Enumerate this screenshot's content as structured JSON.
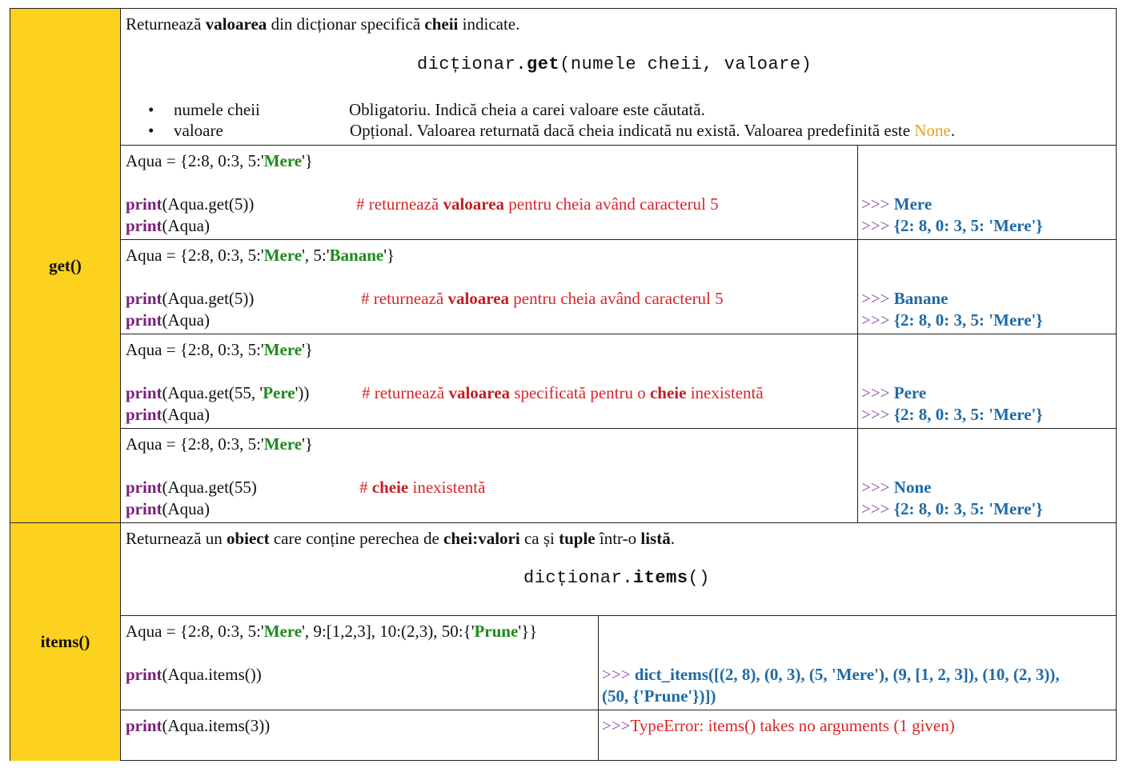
{
  "methods": {
    "get": {
      "name": "get()",
      "desc": {
        "p1": "Returnează ",
        "b1": "valoarea",
        "p2": " din dicționar specifică ",
        "b2": "cheii",
        "p3": " indicate."
      },
      "syntax": {
        "obj": "dicționar.",
        "method": "get",
        "args": "(numele cheii, valoare)"
      },
      "params": [
        {
          "name": "numele cheii",
          "desc": "Obligatoriu. Indică cheia a carei valoare este căutată.",
          "default_label": "",
          "default_value": "",
          "end": ""
        },
        {
          "name": "valoare",
          "desc": "Opțional. Valoarea returnată dacă cheia indicată nu există. Valoarea predefinită este ",
          "default_value": "None",
          "end": "."
        }
      ],
      "examples": [
        {
          "assign_pre": "Aqua = {2:8, 0:3, 5:'",
          "assign_str": "Mere",
          "assign_post": "'}",
          "line1_kw": "print",
          "line1_rest": "(Aqua.get(5))",
          "comment_pre": "# returnează ",
          "comment_b": "valoarea",
          "comment_post": " pentru cheia având caracterul 5",
          "line2_kw": "print",
          "line2_rest": "(Aqua)",
          "out1_prompt": ">>> ",
          "out1": "Mere",
          "out2_prompt": ">>> ",
          "out2": "{2: 8, 0: 3, 5: 'Mere'}"
        },
        {
          "assign_pre": "Aqua = {2:8, 0:3, 5:'",
          "assign_str": "Mere",
          "assign_mid": "', 5:'",
          "assign_str2": "Banane",
          "assign_post": "'}",
          "line1_kw": "print",
          "line1_rest": "(Aqua.get(5))",
          "comment_pre": "# returnează ",
          "comment_b": "valoarea",
          "comment_post": " pentru cheia având caracterul 5",
          "line2_kw": "print",
          "line2_rest": "(Aqua)",
          "out1_prompt": ">>> ",
          "out1": "Banane",
          "out2_prompt": ">>> ",
          "out2": "{2: 8, 0: 3, 5: 'Mere'}"
        },
        {
          "assign_pre": "Aqua = {2:8, 0:3, 5:'",
          "assign_str": "Mere",
          "assign_post": "'}",
          "line1_kw": "print",
          "line1_rest_pre": "(Aqua.get(55, '",
          "line1_str": "Pere",
          "line1_rest_post": "'))",
          "comment_pre": "# returnează ",
          "comment_b": "valoarea",
          "comment_mid": " specificată pentru o ",
          "comment_b2": "cheie",
          "comment_post": " inexistentă",
          "line2_kw": "print",
          "line2_rest": "(Aqua)",
          "out1_prompt": ">>> ",
          "out1": "Pere",
          "out2_prompt": ">>> ",
          "out2": "{2: 8, 0: 3, 5: 'Mere'}"
        },
        {
          "assign_pre": "Aqua = {2:8, 0:3, 5:'",
          "assign_str": "Mere",
          "assign_post": "'}",
          "line1_kw": "print",
          "line1_rest": "(Aqua.get(55)",
          "comment_pre": "# ",
          "comment_b": "cheie",
          "comment_post": " inexistentă",
          "line2_kw": "print",
          "line2_rest": "(Aqua)",
          "out1_prompt": ">>> ",
          "out1": "None",
          "out2_prompt": ">>> ",
          "out2": "{2: 8, 0: 3, 5: 'Mere'}"
        }
      ]
    },
    "items": {
      "name": "items()",
      "desc": {
        "p1": "Returnează un ",
        "b1": "obiect",
        "p2": " care conține perechea de ",
        "b2": "chei:valori",
        "p3": " ca și ",
        "b3": "tuple",
        "p4": " într-o ",
        "b4": "listă",
        "p5": "."
      },
      "syntax": {
        "obj": "dicționar.",
        "method": "items",
        "args": "()"
      },
      "examples": [
        {
          "assign_pre": "Aqua = {2:8, 0:3, 5:'",
          "assign_str": "Mere",
          "assign_mid": "', 9:[1,2,3], 10:(2,3), 50:{'",
          "assign_str2": "Prune",
          "assign_post": "'}}",
          "line1_kw": "print",
          "line1_rest": "(Aqua.items())",
          "out1_prompt": ">>> ",
          "out1": "dict_items([(2, 8), (0, 3), (5, 'Mere'), (9, [1, 2, 3]), (10, (2, 3)),",
          "out1b": "(50, {'Prune'})])"
        },
        {
          "line1_kw": "print",
          "line1_rest": "(Aqua.items(3))",
          "out1_prompt": ">>>",
          "out1": "TypeError: items() takes no arguments (1 given)"
        }
      ]
    }
  }
}
